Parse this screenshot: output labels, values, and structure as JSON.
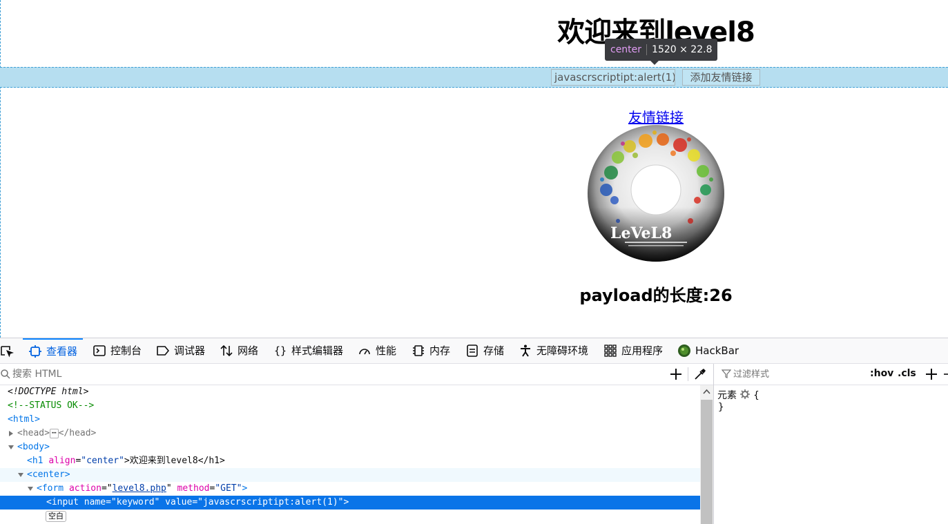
{
  "page": {
    "title": "欢迎来到level8",
    "keyword_value": "javascrscriptipt:alert(1)",
    "submit_label": "添加友情链接",
    "friend_link_label": "友情链接",
    "payload_length_text": "payload的长度:26",
    "logo_text": "LeVeL8"
  },
  "inspector_tooltip": {
    "tag": "center",
    "dimensions": "1520 × 22.8"
  },
  "devtools": {
    "tabs": [
      {
        "label": "查看器",
        "icon": "inspector-icon",
        "active": true
      },
      {
        "label": "控制台",
        "icon": "console-icon"
      },
      {
        "label": "调试器",
        "icon": "debugger-icon"
      },
      {
        "label": "网络",
        "icon": "network-icon"
      },
      {
        "label": "样式编辑器",
        "icon": "style-editor-icon"
      },
      {
        "label": "性能",
        "icon": "performance-icon"
      },
      {
        "label": "内存",
        "icon": "memory-icon"
      },
      {
        "label": "存储",
        "icon": "storage-icon"
      },
      {
        "label": "无障碍环境",
        "icon": "accessibility-icon"
      },
      {
        "label": "应用程序",
        "icon": "application-icon"
      },
      {
        "label": "HackBar",
        "icon": "hackbar-icon"
      }
    ],
    "search_placeholder": "搜索 HTML",
    "filter_placeholder": "过滤样式",
    "hov_label": ":hov",
    "cls_label": ".cls",
    "rule_selector": "元素",
    "rule_open": "{",
    "rule_close": "}",
    "whitespace_badge": "空白",
    "tree": {
      "doctype": "<!DOCTYPE html>",
      "comment": "<!--STATUS OK-->",
      "html_tag": "<html>",
      "head_open": "<head>",
      "head_close": "</head>",
      "ellipsis": "⋯",
      "body_tag": "<body>",
      "h1_open": "<h1",
      "h1_attr_name": "align",
      "h1_attr_value": "\"center\"",
      "h1_content": ">欢迎来到level8</h1>",
      "center_tag": "<center>",
      "form_open": "<form",
      "form_action_name": "action",
      "form_action_value": "level8.php",
      "form_method_name": "method",
      "form_method_value": "\"GET\"",
      "form_end": ">",
      "input_line": "<input name=\"keyword\" value=\"javascrscriptipt:alert(1)\">"
    }
  },
  "colors": {
    "highlight_band": "#b6def0",
    "tooltip_bg": "#3a3b3f",
    "tooltip_tag": "#e29df5",
    "devtools_active": "#0a84ff",
    "selected_row": "#0a74e8",
    "link": "#0000ee"
  }
}
